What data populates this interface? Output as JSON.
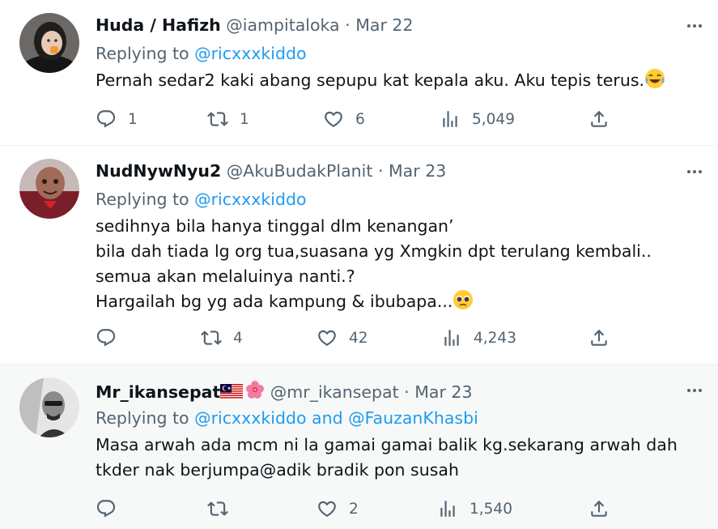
{
  "tweets": [
    {
      "name": "Huda / Hafizh",
      "handle": "@iampitaloka",
      "dot": "·",
      "date": "Mar 22",
      "replying_prefix": "Replying to ",
      "replying_to": "@ricxxxkiddo",
      "replying_joiner": "",
      "replying_to2": "",
      "lines": [
        "Pernah sedar2 kaki abang sepupu kat kepala aku. Aku tepis terus."
      ],
      "emoji": "laughing-tears",
      "replies": "1",
      "retweets": "1",
      "likes": "6",
      "views": "5,049"
    },
    {
      "name": "NudNywNyu2",
      "handle": "@AkuBudakPlanit",
      "dot": "·",
      "date": "Mar 23",
      "replying_prefix": "Replying to ",
      "replying_to": "@ricxxxkiddo",
      "replying_joiner": "",
      "replying_to2": "",
      "lines": [
        "sedihnya bila hanya tinggal dlm kenangan’",
        "bila dah tiada lg org tua,suasana yg Xmgkin dpt terulang kembali..",
        "semua akan melaluinya nanti.?",
        "Hargailah bg yg ada kampung & ibubapa..."
      ],
      "emoji": "pleading-face",
      "replies": "",
      "retweets": "4",
      "likes": "42",
      "views": "4,243"
    },
    {
      "name": "Mr_ikansepat",
      "handle": "@mr_ikansepat",
      "dot": "·",
      "date": "Mar 23",
      "replying_prefix": "Replying to ",
      "replying_to": "@ricxxxkiddo",
      "replying_joiner": " and ",
      "replying_to2": "@FauzanKhasbi",
      "lines": [
        "Masa arwah ada mcm ni la gamai gamai balik kg.sekarang arwah dah",
        "tkder nak berjumpa@adik bradik pon susah"
      ],
      "emoji": "",
      "name_emojis": [
        "malaysia-flag",
        "hibiscus"
      ],
      "replies": "",
      "retweets": "",
      "likes": "2",
      "views": "1,540"
    }
  ],
  "colors": {
    "text": "#0f1419",
    "muted": "#536471",
    "link": "#1d9bf0",
    "divider": "#eff3f4",
    "highlight_bg": "#f7f9f9"
  }
}
